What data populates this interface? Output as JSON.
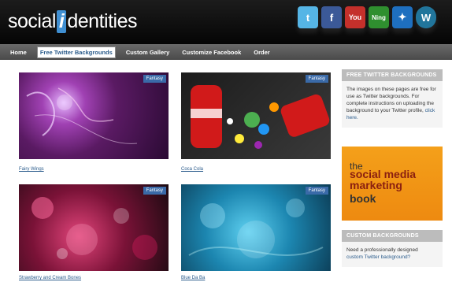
{
  "header": {
    "logo_prefix": "social",
    "logo_i": "i",
    "logo_suffix": "dentities",
    "social_icons": [
      {
        "name": "twitter-icon",
        "label": "t",
        "color": "#55b5e6"
      },
      {
        "name": "facebook-icon",
        "label": "f",
        "color": "#3b5998"
      },
      {
        "name": "youtube-icon",
        "label": "You",
        "color": "#c4302b"
      },
      {
        "name": "ning-icon",
        "label": "Ning",
        "color": "#2f8f2f"
      },
      {
        "name": "myspace-icon",
        "label": "✦",
        "color": "#1e6fbf"
      },
      {
        "name": "wordpress-icon",
        "label": "W",
        "color": "#21759b"
      }
    ]
  },
  "nav": {
    "items": [
      "Home",
      "Free Twitter Backgrounds",
      "Custom Gallery",
      "Customize Facebook",
      "Order"
    ]
  },
  "gallery": {
    "items": [
      {
        "caption": "Fairy Wings",
        "tag": "Fantasy"
      },
      {
        "caption": "Coca Cola",
        "tag": "Fantasy"
      },
      {
        "caption": "Strawberry and Cream Bones",
        "tag": "Fantasy"
      },
      {
        "caption": "Blue Da Ba",
        "tag": "Fantasy"
      }
    ]
  },
  "sidebar": {
    "free_heading": "FREE TWITTER BACKGROUNDS",
    "free_text": "The images on these pages are free for use as Twitter backgrounds. For complete instructions on uploading the background to your Twitter profile,",
    "free_link": "click here.",
    "ad_the": "the",
    "ad_title": "social media marketing",
    "ad_book": "book",
    "custom_heading": "CUSTOM BACKGROUNDS",
    "custom_text": "Need a professionally designed",
    "custom_link": "custom Twitter background?"
  }
}
